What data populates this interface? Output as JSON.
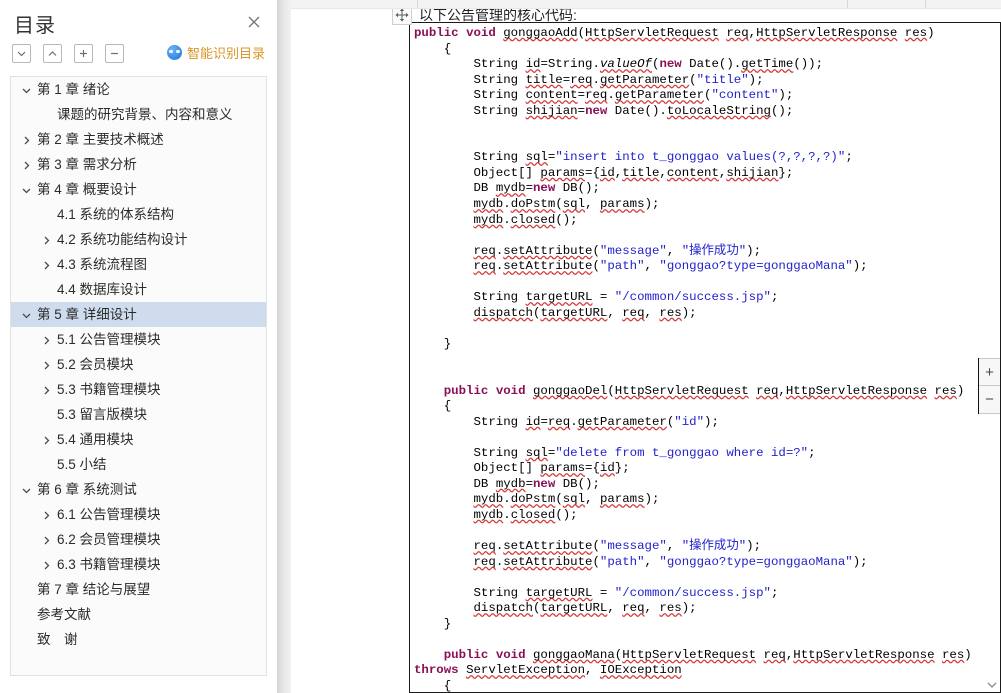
{
  "toc": {
    "title": "目录",
    "close_icon": "close-icon",
    "toolbar": [
      {
        "name": "collapse-down-button",
        "icon": "chevron-down-icon"
      },
      {
        "name": "collapse-up-button",
        "icon": "chevron-up-icon"
      },
      {
        "name": "expand-all-button",
        "icon": "plus-icon"
      },
      {
        "name": "collapse-all-button",
        "icon": "minus-icon"
      }
    ],
    "ai_button": {
      "label": "智能识别目录",
      "icon": "ai-face-icon",
      "color": "#d99526"
    },
    "selection_color": "#cfdcee",
    "items": [
      {
        "label": "第 1 章   绪论",
        "level": 1,
        "caret": "down",
        "selected": false
      },
      {
        "label": "课题的研究背景、内容和意义",
        "level": 2,
        "caret": "none",
        "selected": false
      },
      {
        "label": "第 2 章   主要技术概述",
        "level": 1,
        "caret": "right",
        "selected": false
      },
      {
        "label": "第 3 章   需求分析",
        "level": 1,
        "caret": "right",
        "selected": false
      },
      {
        "label": "第 4 章   概要设计",
        "level": 1,
        "caret": "down",
        "selected": false
      },
      {
        "label": "4.1   系统的体系结构",
        "level": 2,
        "caret": "none",
        "selected": false
      },
      {
        "label": "4.2   系统功能结构设计",
        "level": 2,
        "caret": "right",
        "selected": false
      },
      {
        "label": "4.3   系统流程图",
        "level": 2,
        "caret": "right",
        "selected": false
      },
      {
        "label": "4.4   数据库设计",
        "level": 2,
        "caret": "none",
        "selected": false
      },
      {
        "label": "第 5 章   详细设计",
        "level": 1,
        "caret": "down",
        "selected": true
      },
      {
        "label": "5.1   公告管理模块",
        "level": 2,
        "caret": "right",
        "selected": false
      },
      {
        "label": "5.2   会员模块",
        "level": 2,
        "caret": "right",
        "selected": false
      },
      {
        "label": "5.3   书籍管理模块",
        "level": 2,
        "caret": "right",
        "selected": false
      },
      {
        "label": "5.3   留言版模块",
        "level": 2,
        "caret": "none",
        "selected": false
      },
      {
        "label": "5.4   通用模块",
        "level": 2,
        "caret": "right",
        "selected": false
      },
      {
        "label": "5.5   小结",
        "level": 2,
        "caret": "none",
        "selected": false
      },
      {
        "label": "第 6 章   系统测试",
        "level": 1,
        "caret": "down",
        "selected": false
      },
      {
        "label": "6.1   公告管理模块",
        "level": 2,
        "caret": "right",
        "selected": false
      },
      {
        "label": "6.2   会员管理模块",
        "level": 2,
        "caret": "right",
        "selected": false
      },
      {
        "label": "6.3   书籍管理模块",
        "level": 2,
        "caret": "right",
        "selected": false
      },
      {
        "label": "第 7 章   结论与展望",
        "level": 1,
        "caret": "none",
        "selected": false
      },
      {
        "label": "参考文献",
        "level": 1,
        "caret": "none",
        "selected": false
      },
      {
        "label": "致　谢",
        "level": 1,
        "caret": "none",
        "selected": false
      }
    ]
  },
  "document": {
    "heading": "以下公告管理的核心代码:",
    "move_handle_icon": "move-handle-icon",
    "code_language": "java",
    "syntax_colors": {
      "keyword": "#8a0f55",
      "string": "#2222cc",
      "text": "#000000",
      "spellcheck_underline": "#d43c3c"
    },
    "code_lines": [
      "public void gonggaoAdd(HttpServletRequest req,HttpServletResponse res)",
      "    {",
      "        String id=String.valueOf(new Date().getTime());",
      "        String title=req.getParameter(\"title\");",
      "        String content=req.getParameter(\"content\");",
      "        String shijian=new Date().toLocaleString();",
      "",
      "",
      "        String sql=\"insert into t_gonggao values(?,?,?,?)\";",
      "        Object[] params={id,title,content,shijian};",
      "        DB mydb=new DB();",
      "        mydb.doPstm(sql, params);",
      "        mydb.closed();",
      "",
      "        req.setAttribute(\"message\", \"操作成功\");",
      "        req.setAttribute(\"path\", \"gonggao?type=gonggaoMana\");",
      "",
      "        String targetURL = \"/common/success.jsp\";",
      "        dispatch(targetURL, req, res);",
      "",
      "    }",
      "",
      "",
      "    public void gonggaoDel(HttpServletRequest req,HttpServletResponse res)",
      "    {",
      "        String id=req.getParameter(\"id\");",
      "",
      "        String sql=\"delete from t_gonggao where id=?\";",
      "        Object[] params={id};",
      "        DB mydb=new DB();",
      "        mydb.doPstm(sql, params);",
      "        mydb.closed();",
      "",
      "        req.setAttribute(\"message\", \"操作成功\");",
      "        req.setAttribute(\"path\", \"gonggao?type=gonggaoMana\");",
      "",
      "        String targetURL = \"/common/success.jsp\";",
      "        dispatch(targetURL, req, res);",
      "    }",
      "",
      "    public void gonggaoMana(HttpServletRequest req,HttpServletResponse res) throws ServletException, IOException",
      "    {"
    ]
  },
  "controls": {
    "zoom_in": "+",
    "zoom_out": "−",
    "scroll_down_icon": "scroll-down-icon"
  }
}
